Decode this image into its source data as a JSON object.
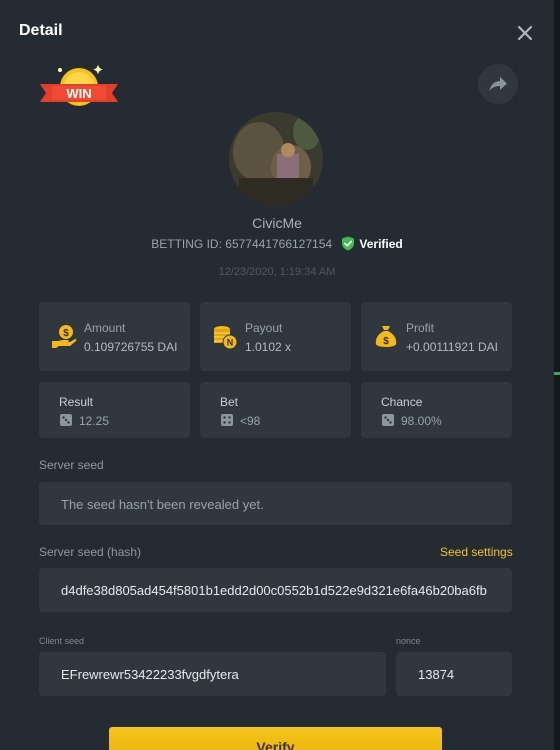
{
  "header": {
    "title": "Detail"
  },
  "badge": {
    "text": "WIN"
  },
  "player": {
    "username": "CivicMe",
    "betting_id_label": "BETTING ID:",
    "betting_id": "6577441766127154",
    "verified_label": "Verified",
    "timestamp": "12/23/2020, 1:19:34 AM"
  },
  "stats": {
    "amount": {
      "label": "Amount",
      "value": "0.109726755 DAI",
      "icon": "money-hand-icon"
    },
    "payout": {
      "label": "Payout",
      "value": "1.0102 x",
      "icon": "coins-stack-icon"
    },
    "profit": {
      "label": "Profit",
      "value": "+0.00111921 DAI",
      "icon": "money-bag-icon"
    },
    "result": {
      "label": "Result",
      "value": "12.25",
      "icon": "dice-icon"
    },
    "bet": {
      "label": "Bet",
      "value": "<98",
      "icon": "dice-icon"
    },
    "chance": {
      "label": "Chance",
      "value": "98.00%",
      "icon": "dice-icon"
    }
  },
  "server_seed": {
    "label": "Server seed",
    "value": "The seed hasn't been revealed yet."
  },
  "server_seed_hash": {
    "label": "Server seed (hash)",
    "settings_link": "Seed settings",
    "value": "d4dfe38d805ad454f5801b1edd2d00c0552b1d522e9d321e6fa46b20ba6fb"
  },
  "client_seed": {
    "label": "Client seed",
    "value": "EFrewrewr53422233fvgdfytera"
  },
  "nonce": {
    "label": "nonce",
    "value": "13874"
  },
  "verify": {
    "label": "Verify"
  },
  "colors": {
    "modal_bg": "#252b32",
    "card_bg": "#30373f",
    "accent_yellow": "#f5c518",
    "verified_green": "#3dbb4e"
  }
}
